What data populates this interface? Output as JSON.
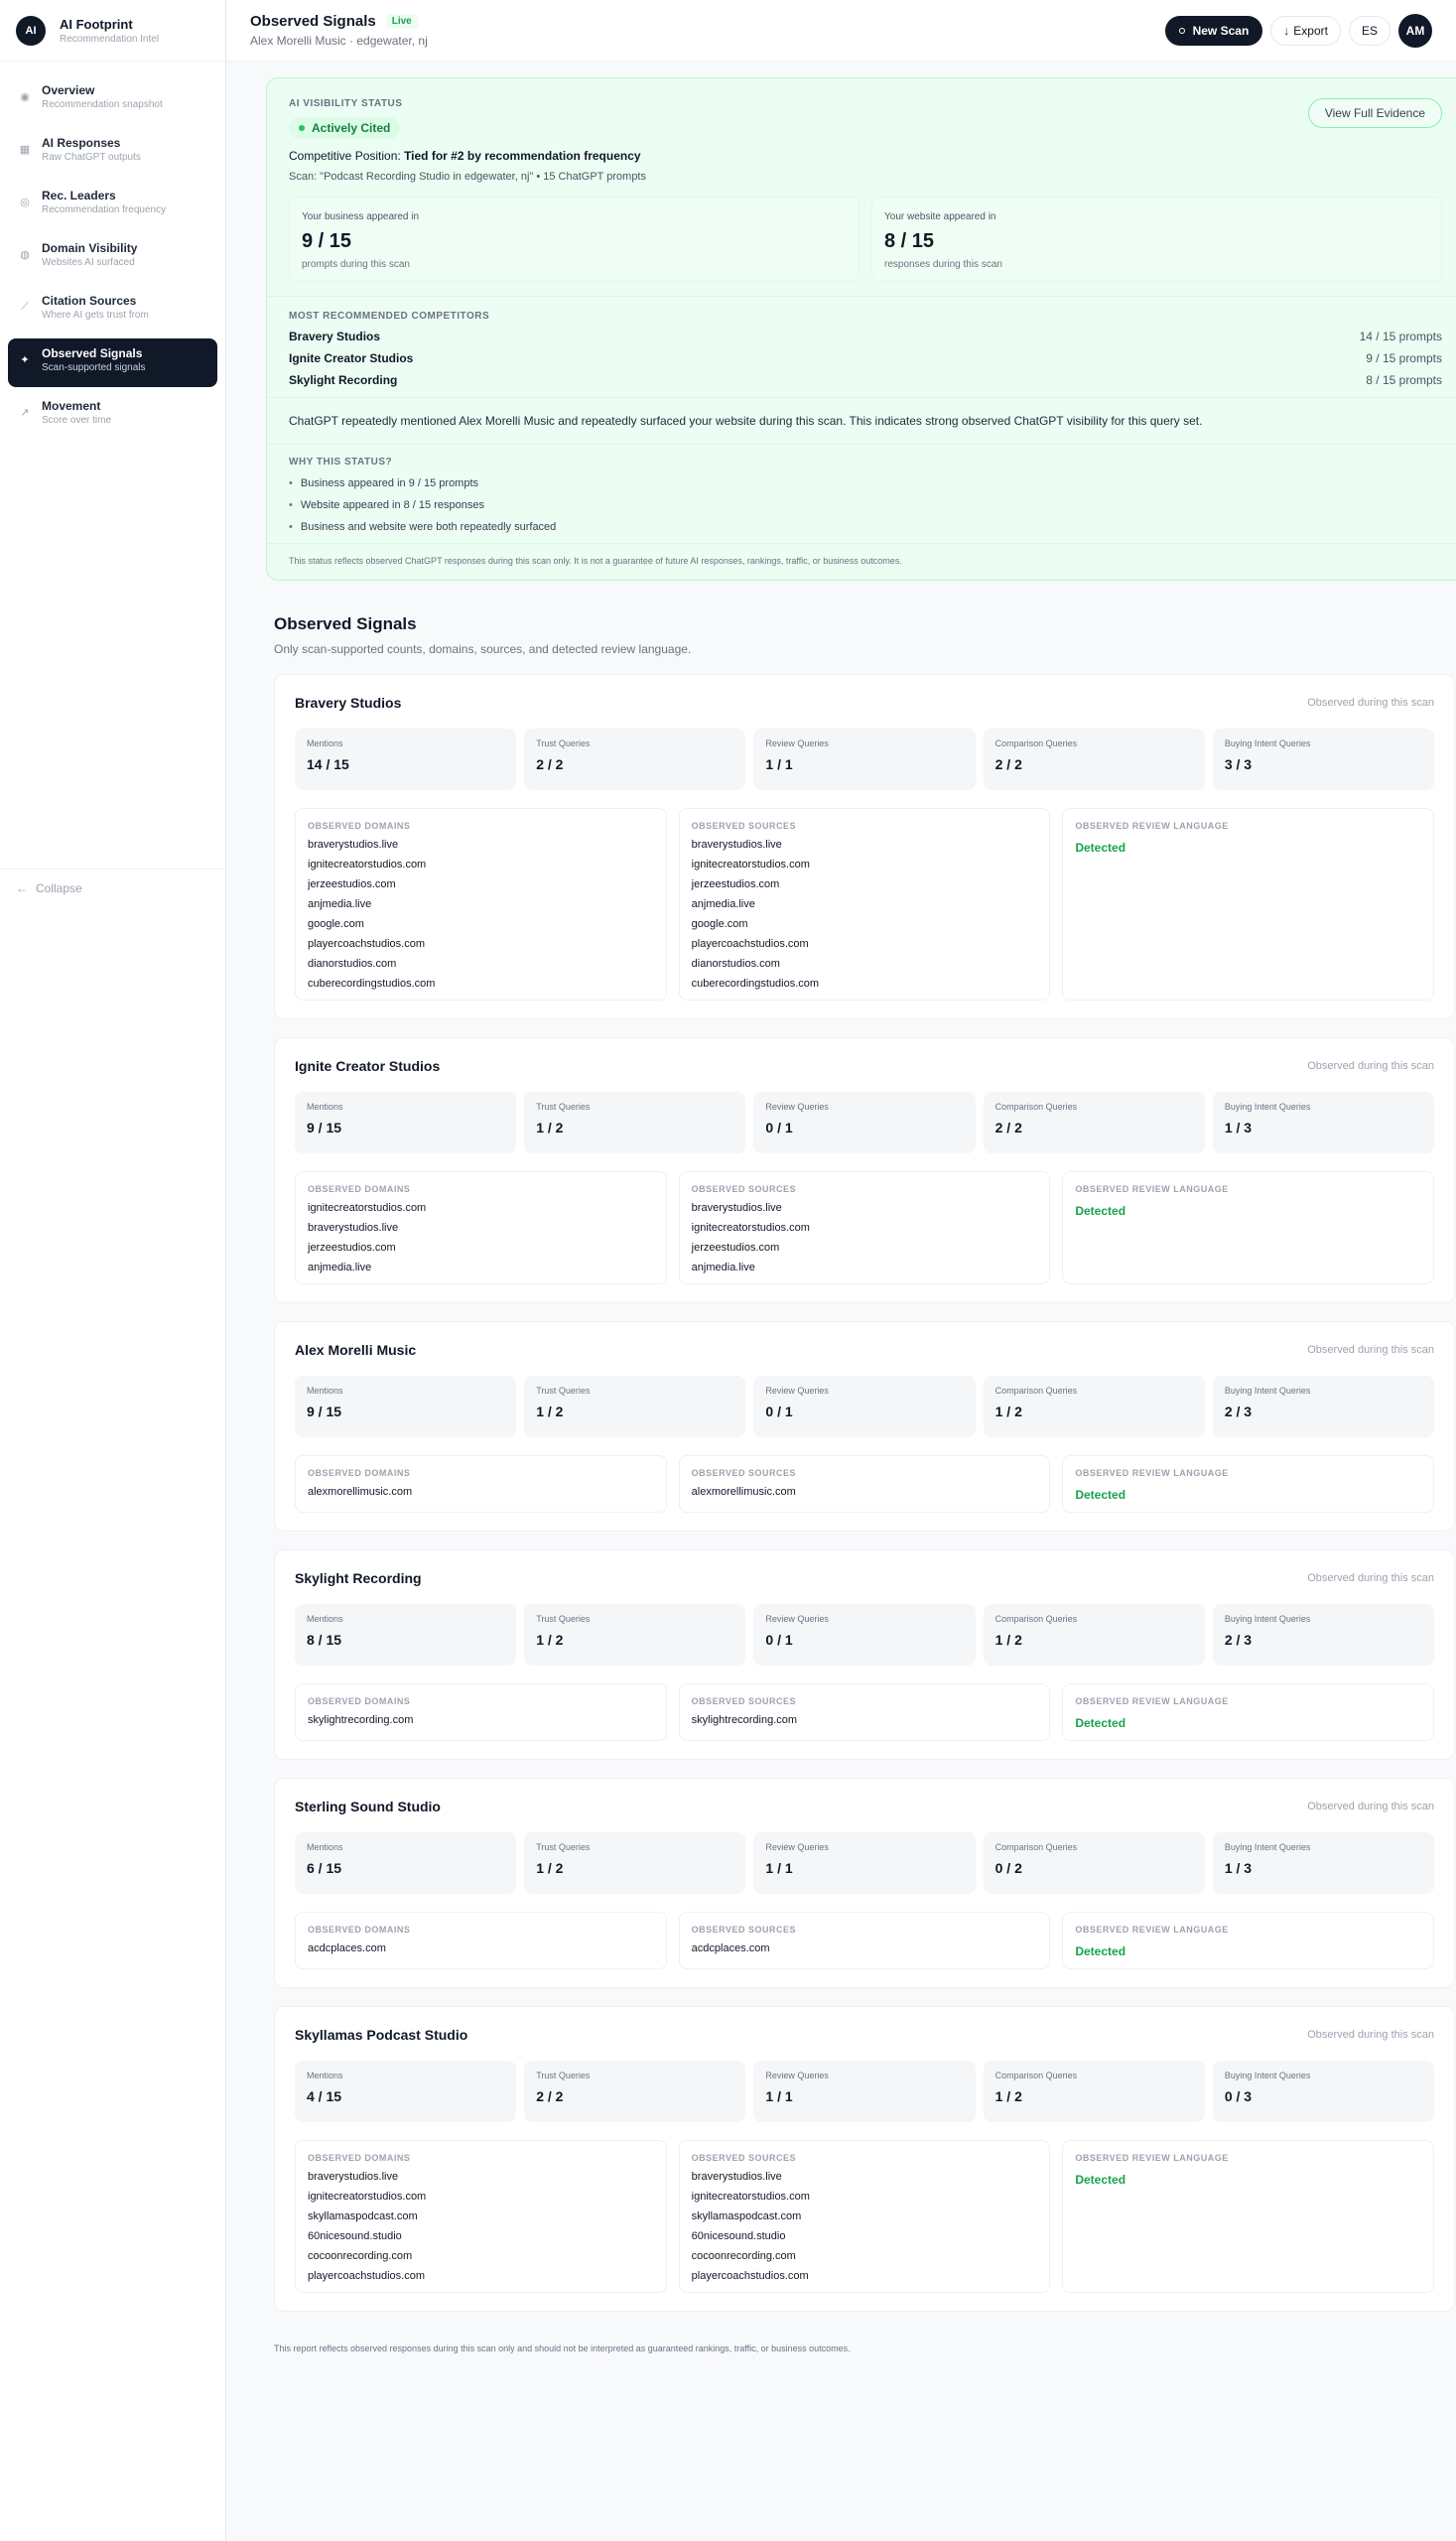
{
  "brand": {
    "logo": "AI",
    "title": "AI Footprint",
    "subtitle": "Recommendation Intel"
  },
  "sidebar": {
    "items": [
      {
        "label": "Overview",
        "sub": "Recommendation snapshot",
        "icon": "circle-icon"
      },
      {
        "label": "AI Responses",
        "sub": "Raw ChatGPT outputs",
        "icon": "grid-icon"
      },
      {
        "label": "Rec. Leaders",
        "sub": "Recommendation frequency",
        "icon": "target-icon"
      },
      {
        "label": "Domain Visibility",
        "sub": "Websites AI surfaced",
        "icon": "globe-icon"
      },
      {
        "label": "Citation Sources",
        "sub": "Where AI gets trust from",
        "icon": "link-icon"
      },
      {
        "label": "Observed Signals",
        "sub": "Scan-supported signals",
        "icon": "sparkle-icon",
        "active": true
      },
      {
        "label": "Movement",
        "sub": "Score over time",
        "icon": "trend-icon"
      }
    ],
    "collapse_label": "Collapse"
  },
  "header": {
    "title": "Observed Signals",
    "badge": "Live",
    "subtitle": "Alex Morelli Music · edgewater, nj",
    "new_scan": "New Scan",
    "export": "Export",
    "lang": "ES",
    "avatar": "AM"
  },
  "status": {
    "caption": "AI VISIBILITY STATUS",
    "badge": "Actively Cited",
    "position_label": "Competitive Position:",
    "position_value": "Tied for #2 by recommendation frequency",
    "scan_line": "Scan: \"Podcast Recording Studio in edgewater, nj\" • 15 ChatGPT prompts",
    "view_button": "View Full Evidence",
    "business": {
      "label": "Your business appeared in",
      "value": "9 / 15",
      "sub": "prompts during this scan"
    },
    "website": {
      "label": "Your website appeared in",
      "value": "8 / 15",
      "sub": "responses during this scan"
    },
    "competitors_caption": "MOST RECOMMENDED COMPETITORS",
    "competitors": [
      {
        "name": "Bravery Studios",
        "count": "14 / 15 prompts"
      },
      {
        "name": "Ignite Creator Studios",
        "count": "9 / 15 prompts"
      },
      {
        "name": "Skylight Recording",
        "count": "8 / 15 prompts"
      }
    ],
    "summary": "ChatGPT repeatedly mentioned Alex Morelli Music and repeatedly surfaced your website during this scan. This indicates strong observed ChatGPT visibility for this query set.",
    "why_caption": "WHY THIS STATUS?",
    "why": [
      "Business appeared in 9 / 15 prompts",
      "Website appeared in 8 / 15 responses",
      "Business and website were both repeatedly surfaced"
    ],
    "disclaimer": "This status reflects observed ChatGPT responses during this scan only. It is not a guarantee of future AI responses, rankings, traffic, or business outcomes."
  },
  "signals": {
    "title": "Observed Signals",
    "subtitle": "Only scan-supported counts, domains, sources, and detected review language.",
    "observed_label": "Observed during this scan",
    "metric_labels": [
      "Mentions",
      "Trust Queries",
      "Review Queries",
      "Comparison Queries",
      "Buying Intent Queries"
    ],
    "domains_caption": "OBSERVED DOMAINS",
    "sources_caption": "OBSERVED SOURCES",
    "review_caption": "OBSERVED REVIEW LANGUAGE",
    "cards": [
      {
        "name": "Bravery Studios",
        "metrics": [
          "14 / 15",
          "2 / 2",
          "1 / 1",
          "2 / 2",
          "3 / 3"
        ],
        "domains": [
          "braverystudios.live",
          "ignitecreatorstudios.com",
          "jerzeestudios.com",
          "anjmedia.live",
          "google.com",
          "playercoachstudios.com",
          "dianorstudios.com",
          "cuberecordingstudios.com"
        ],
        "sources": [
          "braverystudios.live",
          "ignitecreatorstudios.com",
          "jerzeestudios.com",
          "anjmedia.live",
          "google.com",
          "playercoachstudios.com",
          "dianorstudios.com",
          "cuberecordingstudios.com"
        ],
        "review": "Detected"
      },
      {
        "name": "Ignite Creator Studios",
        "metrics": [
          "9 / 15",
          "1 / 2",
          "0 / 1",
          "2 / 2",
          "1 / 3"
        ],
        "domains": [
          "ignitecreatorstudios.com",
          "braverystudios.live",
          "jerzeestudios.com",
          "anjmedia.live"
        ],
        "sources": [
          "braverystudios.live",
          "ignitecreatorstudios.com",
          "jerzeestudios.com",
          "anjmedia.live"
        ],
        "review": "Detected"
      },
      {
        "name": "Alex Morelli Music",
        "metrics": [
          "9 / 15",
          "1 / 2",
          "0 / 1",
          "1 / 2",
          "2 / 3"
        ],
        "domains": [
          "alexmorellimusic.com"
        ],
        "sources": [
          "alexmorellimusic.com"
        ],
        "review": "Detected"
      },
      {
        "name": "Skylight Recording",
        "metrics": [
          "8 / 15",
          "1 / 2",
          "0 / 1",
          "1 / 2",
          "2 / 3"
        ],
        "domains": [
          "skylightrecording.com"
        ],
        "sources": [
          "skylightrecording.com"
        ],
        "review": "Detected"
      },
      {
        "name": "Sterling Sound Studio",
        "metrics": [
          "6 / 15",
          "1 / 2",
          "1 / 1",
          "0 / 2",
          "1 / 3"
        ],
        "domains": [
          "acdcplaces.com"
        ],
        "sources": [
          "acdcplaces.com"
        ],
        "review": "Detected"
      },
      {
        "name": "Skyllamas Podcast Studio",
        "metrics": [
          "4 / 15",
          "2 / 2",
          "1 / 1",
          "1 / 2",
          "0 / 3"
        ],
        "domains": [
          "braverystudios.live",
          "ignitecreatorstudios.com",
          "skyllamaspodcast.com",
          "60nicesound.studio",
          "cocoonrecording.com",
          "playercoachstudios.com"
        ],
        "sources": [
          "braverystudios.live",
          "ignitecreatorstudios.com",
          "skyllamaspodcast.com",
          "60nicesound.studio",
          "cocoonrecording.com",
          "playercoachstudios.com"
        ],
        "review": "Detected"
      }
    ]
  },
  "footer": "This report reflects observed responses during this scan only and should not be interpreted as guaranteed rankings, traffic, or business outcomes.",
  "colors": {
    "accent_dark": "#111827",
    "status_bg": "#ecfdf3",
    "detected_green": "#16a34a"
  }
}
